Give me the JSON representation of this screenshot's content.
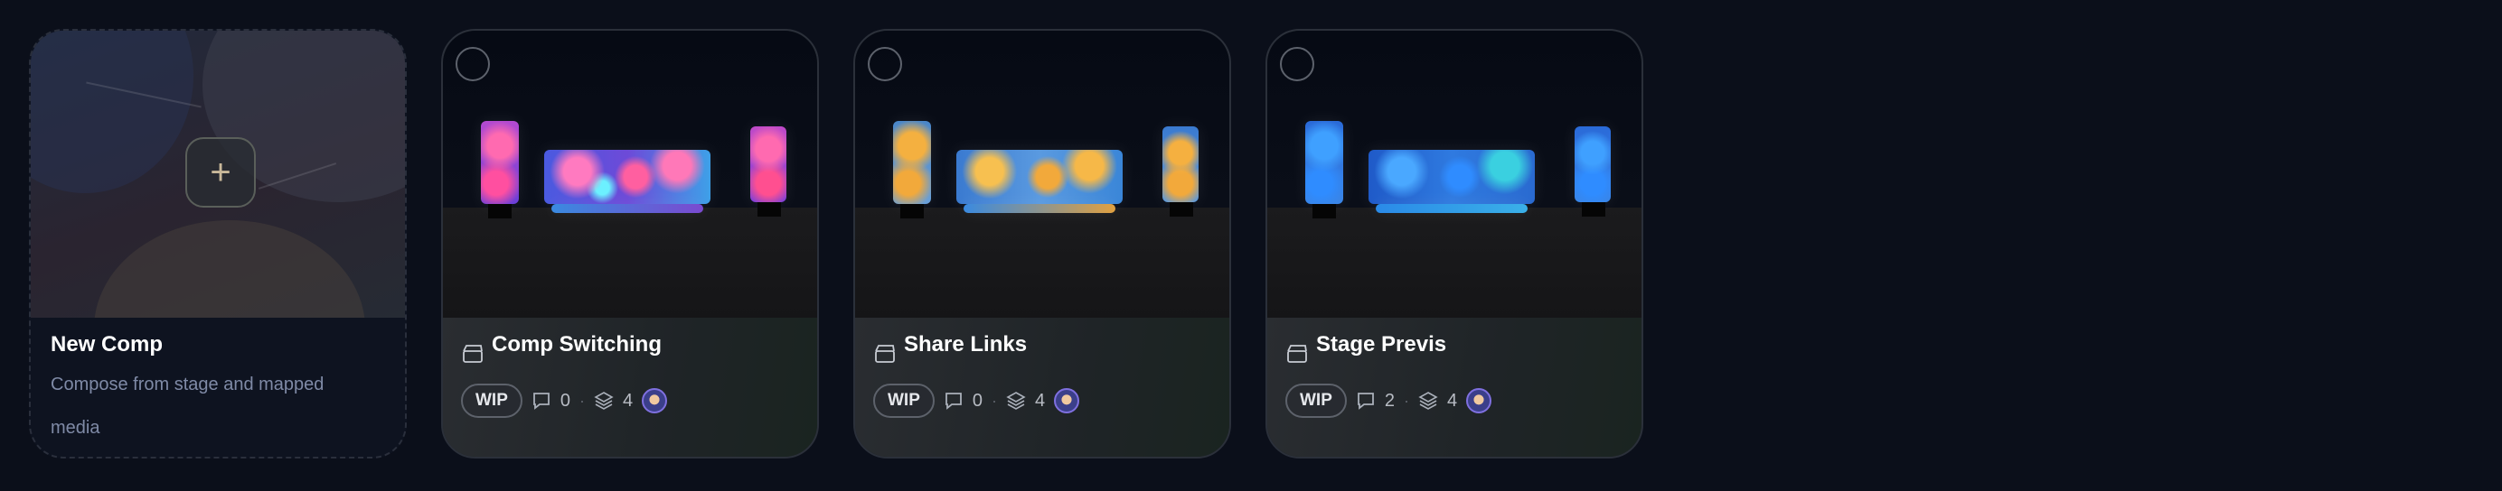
{
  "new_comp": {
    "title": "New Comp",
    "subtitle": "Compose from stage and mapped media"
  },
  "comps": [
    {
      "title": "Comp Switching",
      "status": "WIP",
      "comments": "0",
      "layers": "4",
      "palette": "pink"
    },
    {
      "title": "Share Links",
      "status": "WIP",
      "comments": "0",
      "layers": "4",
      "palette": "gold"
    },
    {
      "title": "Stage Previs",
      "status": "WIP",
      "comments": "2",
      "layers": "4",
      "palette": "blue"
    }
  ],
  "colors": {
    "background": "#0b0f1a",
    "card_border": "#2b303a",
    "pink_screen": "#ff5fa0",
    "gold_screen": "#f2a93b",
    "blue_screen": "#2f8cff"
  },
  "icons": [
    "plus-icon",
    "select-circle-icon",
    "clapperboard-icon",
    "comment-icon",
    "layers-icon",
    "user-avatar"
  ]
}
